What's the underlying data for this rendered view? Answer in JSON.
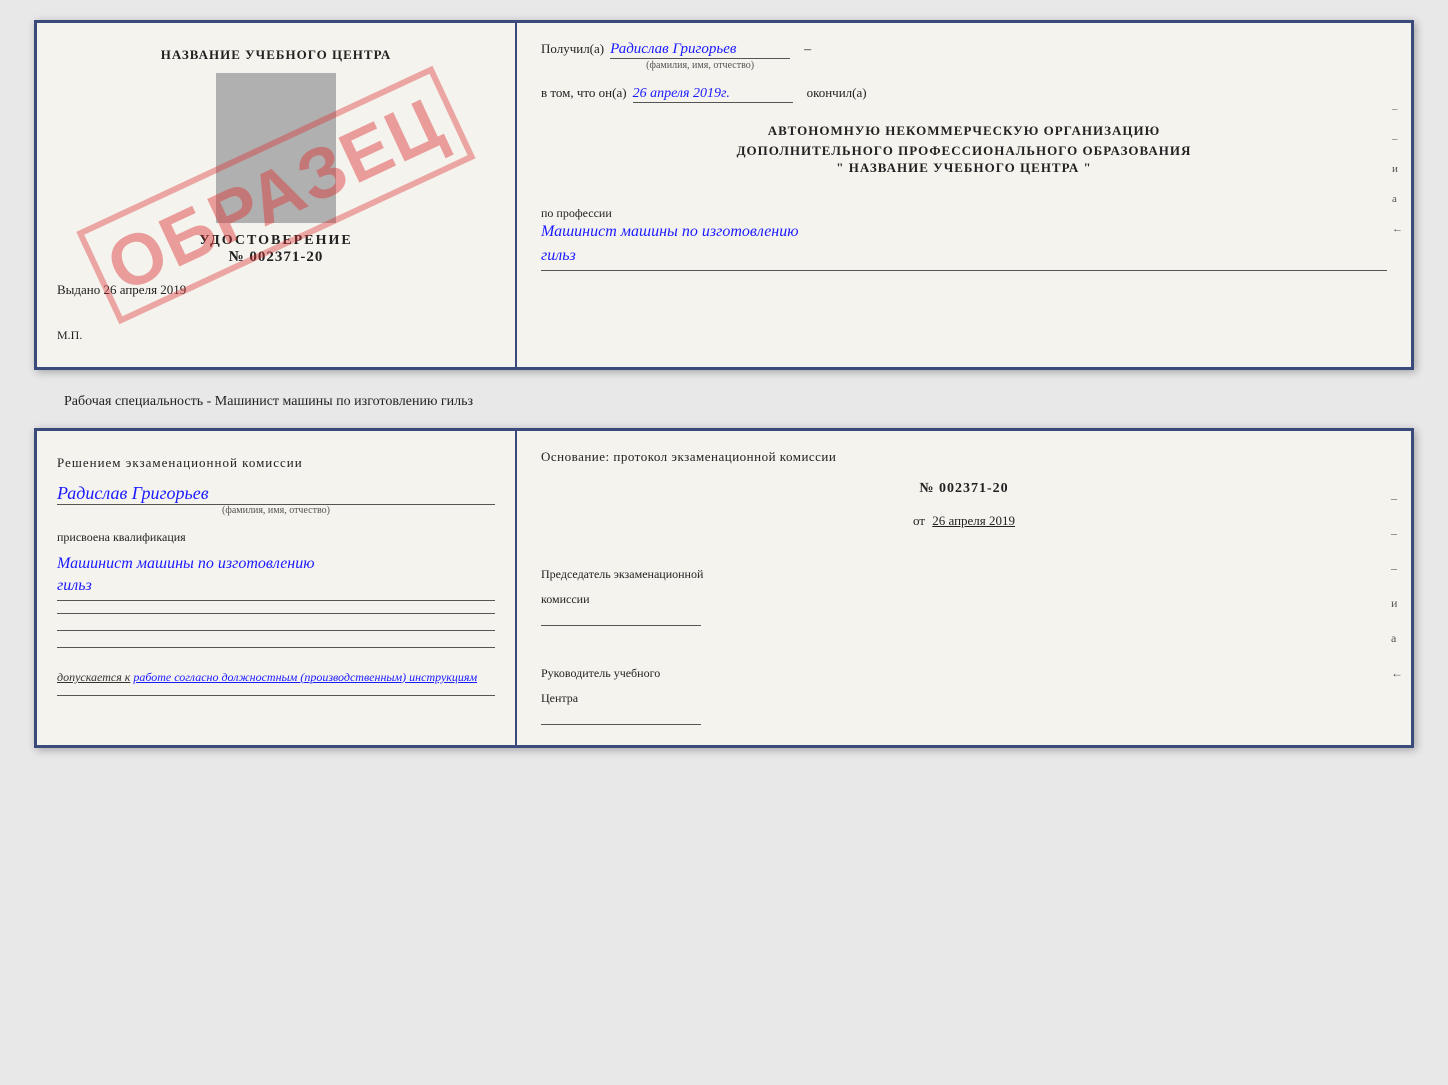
{
  "doc1": {
    "left": {
      "title": "НАЗВАНИЕ УЧЕБНОГО ЦЕНТРА",
      "cert_label": "УДОСТОВЕРЕНИЕ",
      "cert_number": "№ 002371-20",
      "issued_label": "Выдано",
      "issued_date": "26 апреля 2019",
      "stamp_label": "М.П.",
      "watermark": "ОБРАЗЕЦ"
    },
    "right": {
      "received_label": "Получил(а)",
      "received_value": "Радислав Григорьев",
      "received_sub": "(фамилия, имя, отчество)",
      "in_that_label": "в том, что он(а)",
      "date_value": "26 апреля 2019г.",
      "finished_label": "окончил(а)",
      "org_line1": "АВТОНОМНУЮ НЕКОММЕРЧЕСКУЮ ОРГАНИЗАЦИЮ",
      "org_line2": "ДОПОЛНИТЕЛЬНОГО ПРОФЕССИОНАЛЬНОГО ОБРАЗОВАНИЯ",
      "org_name": "\"   НАЗВАНИЕ УЧЕБНОГО ЦЕНТРА   \"",
      "profession_label": "по профессии",
      "profession_value": "Машинист машины по изготовлению",
      "profession_value2": "гильз",
      "dash1": "–",
      "dash2": "–",
      "letter_i": "и",
      "letter_a": "а",
      "arrow": "←"
    }
  },
  "subtitle": "Рабочая специальность - Машинист машины по изготовлению гильз",
  "doc2": {
    "left": {
      "decision_label": "Решением  экзаменационной  комиссии",
      "name_value": "Радислав Григорьев",
      "name_sub": "(фамилия, имя, отчество)",
      "assigned_label": "присвоена квалификация",
      "qualification_value": "Машинист машины по изготовлению",
      "qualification_value2": "гильз",
      "admit_label": "допускается к",
      "admit_value": "работе согласно должностным (производственным) инструкциям"
    },
    "right": {
      "basis_label": "Основание: протокол экзаменационной  комиссии",
      "number_label": "№",
      "number_value": "002371-20",
      "date_prefix": "от",
      "date_value": "26 апреля 2019",
      "chairman_line1": "Председатель экзаменационной",
      "chairman_line2": "комиссии",
      "director_line1": "Руководитель учебного",
      "director_line2": "Центра",
      "dash1": "–",
      "dash2": "–",
      "dash3": "–",
      "letter_i": "и",
      "letter_a": "а",
      "arrow": "←"
    }
  }
}
